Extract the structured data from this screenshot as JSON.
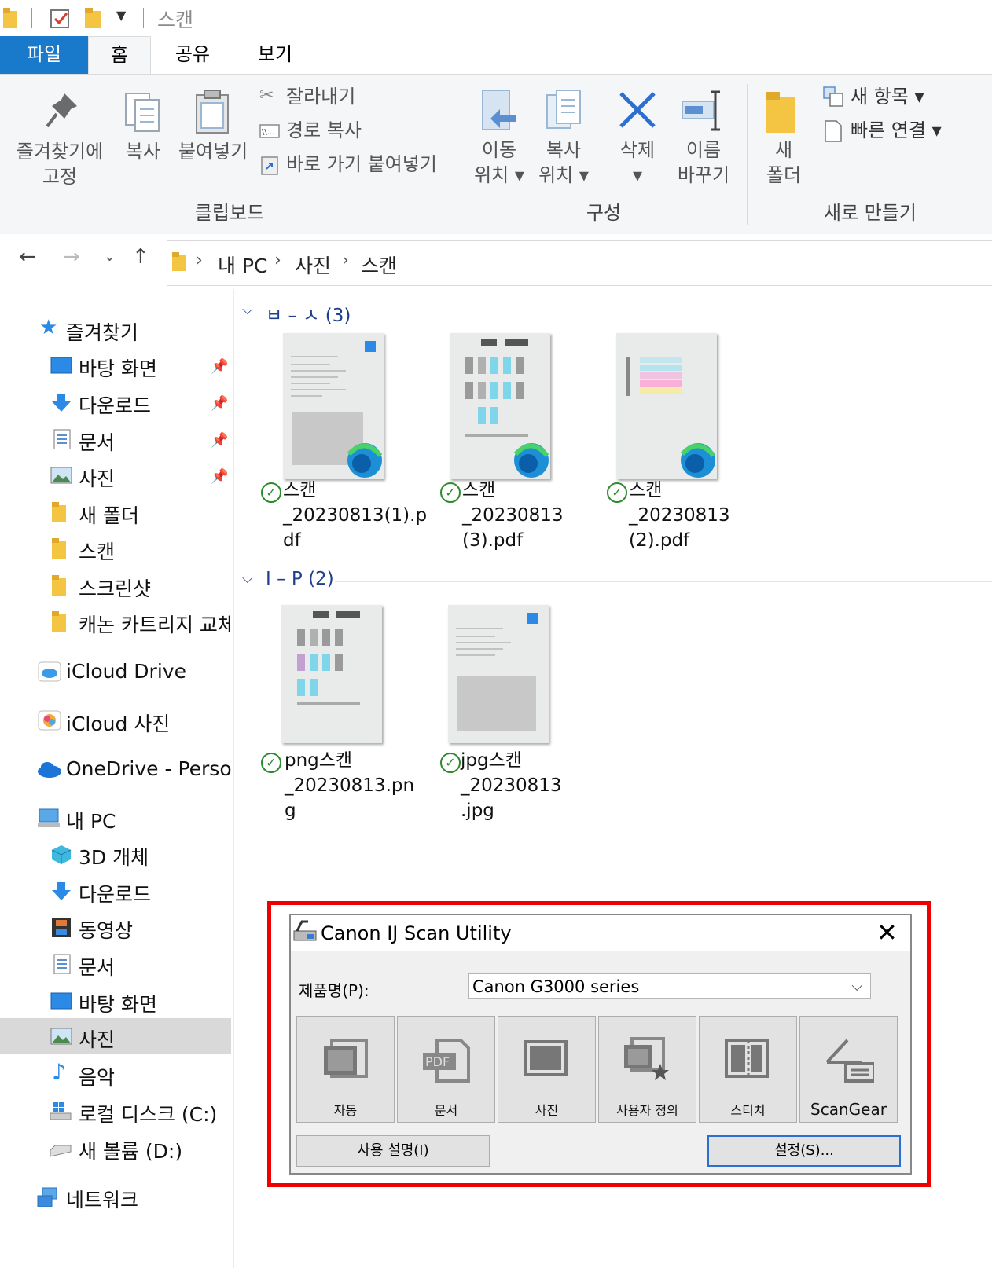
{
  "window": {
    "title": "스캔"
  },
  "ribbon_tabs": {
    "file": "파일",
    "home": "홈",
    "share": "공유",
    "view": "보기"
  },
  "ribbon": {
    "pin_quick_access": "즐겨찾기에\n고정",
    "copy": "복사",
    "paste": "붙여넣기",
    "cut": "잘라내기",
    "copy_path": "경로 복사",
    "paste_shortcut": "바로 가기 붙여넣기",
    "group_clipboard": "클립보드",
    "move_to": "이동\n위치 ▾",
    "copy_to": "복사\n위치 ▾",
    "delete": "삭제\n▾",
    "rename": "이름\n바꾸기",
    "group_organize": "구성",
    "new_folder": "새\n폴더",
    "new_item": "새 항목 ▾",
    "easy_access": "빠른 연결 ▾",
    "group_new": "새로 만들기"
  },
  "address": {
    "crumbs": [
      "내 PC",
      "사진",
      "스캔"
    ]
  },
  "nav": {
    "quick_access": "즐겨찾기",
    "items": [
      "바탕 화면",
      "다운로드",
      "문서",
      "사진",
      "새 폴더",
      "스캔",
      "스크린샷",
      "캐논 카트리지 교체"
    ],
    "icloud_drive": "iCloud Drive",
    "icloud_photos": "iCloud 사진",
    "onedrive": "OneDrive - Personal",
    "this_pc": "내 PC",
    "pc_items": [
      "3D 개체",
      "다운로드",
      "동영상",
      "문서",
      "바탕 화면",
      "사진",
      "음악",
      "로컬 디스크 (C:)",
      "새 볼륨 (D:)"
    ],
    "network": "네트워크"
  },
  "content": {
    "group1": {
      "header": "ㅂ – ㅅ (3)"
    },
    "files1": [
      "스캔\n_20230813(1).p\ndf",
      "스캔\n_20230813\n(3).pdf",
      "스캔\n_20230813\n(2).pdf"
    ],
    "group2": {
      "header": "I – P (2)"
    },
    "files2": [
      "png스캔\n_20230813.pn\ng",
      "jpg스캔\n_20230813\n.jpg"
    ]
  },
  "dialog": {
    "title": "Canon IJ Scan Utility",
    "product_label": "제품명(P):",
    "product_value": "Canon G3000 series",
    "buttons": [
      "자동",
      "문서",
      "사진",
      "사용자 정의",
      "스티치",
      "ScanGear"
    ],
    "manual": "사용 설명(I)",
    "settings": "설정(S)..."
  },
  "colors": {
    "file_tab": "#1979ca",
    "highlight_frame": "#ee0000",
    "nav_selected": "#d9d9d9",
    "check": "#2d8a2d"
  }
}
